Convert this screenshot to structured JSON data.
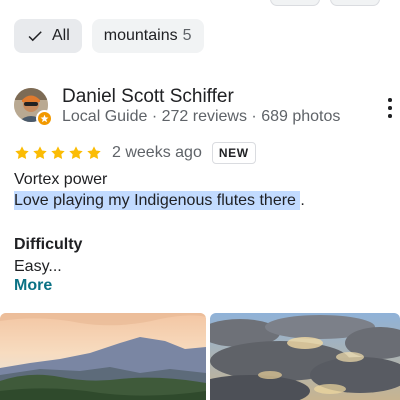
{
  "filters": {
    "all_label": "All",
    "mountains_label": "mountains",
    "mountains_count": "5"
  },
  "review": {
    "reviewer_name": "Daniel Scott Schiffer",
    "reviewer_meta": "Local Guide · 272 reviews · 689 photos",
    "rating": 5,
    "date": "2 weeks ago",
    "badge": "NEW",
    "line1": "Vortex power",
    "line2_highlighted": "Love playing my Indigenous flutes there ",
    "line2_rest": ".",
    "section_heading": "Difficulty",
    "section_text": "Easy...",
    "more_label": "More"
  },
  "icons": {
    "check": "check-icon",
    "star": "star-icon",
    "more": "more-vert-icon",
    "local_guide": "local-guide-badge-icon"
  },
  "colors": {
    "star": "#fbbc04",
    "highlight": "#c2dbff",
    "link": "#0b7285",
    "chip_selected": "#e8eaed",
    "chip": "#f1f3f4",
    "badge": "#f29900"
  }
}
